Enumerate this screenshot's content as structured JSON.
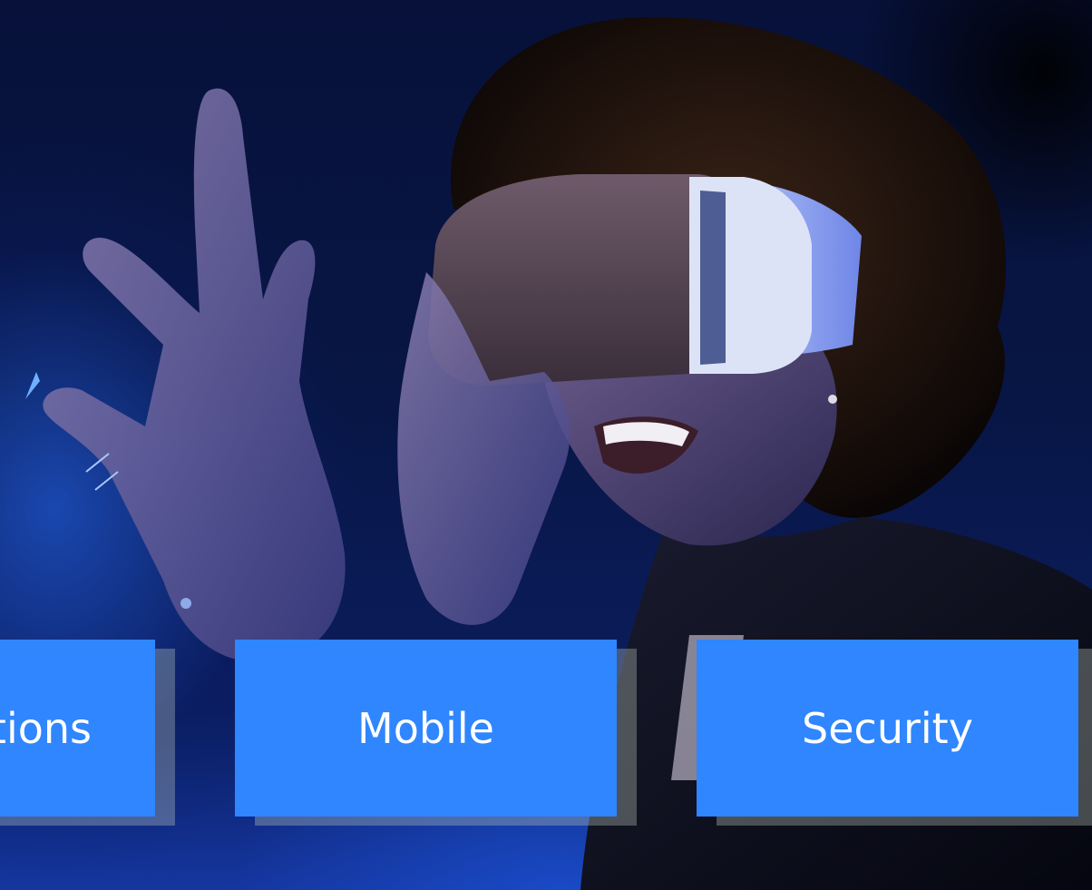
{
  "hero": {
    "image_description_icon": "vr-headset-person-photo"
  },
  "categories": [
    {
      "label": "Applications"
    },
    {
      "label": "Mobile"
    },
    {
      "label": "Security"
    }
  ],
  "colors": {
    "tile_bg": "#2f86ff",
    "tile_text": "#ffffff",
    "background": "#07113a"
  }
}
